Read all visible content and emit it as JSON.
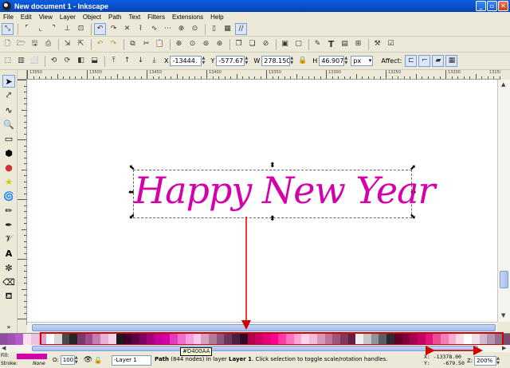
{
  "window": {
    "title": "New document 1 - Inkscape"
  },
  "menu": [
    "File",
    "Edit",
    "View",
    "Layer",
    "Object",
    "Path",
    "Text",
    "Filters",
    "Extensions",
    "Help"
  ],
  "toolbar": {
    "x_label": "X",
    "x_value": "-13444.",
    "y_label": "Y",
    "y_value": "-577.67",
    "w_label": "W",
    "w_value": "278.15C",
    "h_label": "H",
    "h_value": "46.907",
    "unit": "px",
    "affect_label": "Affect:"
  },
  "rulers": {
    "h_labels": [
      "13550",
      "13500",
      "13450",
      "13400",
      "13350",
      "13300",
      "13250",
      "13200",
      "13150"
    ]
  },
  "canvas": {
    "text": "Happy New Year",
    "text_color": "#d400aa"
  },
  "palette": {
    "tooltip": "#D400AA",
    "colors": [
      "#8f4e9e",
      "#a34fb3",
      "#b55cc9",
      "#f6e2f2",
      "#ecc2e3",
      "#d9a2cf",
      "#fbfbfb",
      "#d7d7d7",
      "#4a4a4a",
      "#262626",
      "#7a3a6e",
      "#9b4e8b",
      "#c27db3",
      "#e6b1d8",
      "#f0d4e8",
      "#1a1a1a",
      "#3b0030",
      "#5c0049",
      "#800066",
      "#a30082",
      "#c6009e",
      "#d400aa",
      "#e33abf",
      "#ee6fd1",
      "#f59ee0",
      "#fac8ee",
      "#d4a3c0",
      "#b07a9d",
      "#8c577c",
      "#6a365c",
      "#4b1f41",
      "#2f0a28",
      "#b3004e",
      "#cc0063",
      "#e6007a",
      "#ff0090",
      "#ff3aa8",
      "#ff72c0",
      "#ffa6d6",
      "#ffd4ea",
      "#f0bcd8",
      "#d698b9",
      "#bb7699",
      "#9f567b",
      "#82385e",
      "#661e44",
      "#eef0f0",
      "#c3c6c8",
      "#909498",
      "#5a5e62",
      "#2a2d30",
      "#640027",
      "#82003a",
      "#a6004f",
      "#c80066",
      "#e0147f",
      "#ed4b9a",
      "#f47cb6",
      "#f9abd0",
      "#fdd6e8",
      "#ffffff",
      "#ece0ea",
      "#d0b9cc",
      "#b494ae",
      "#966f8f",
      "#784d71"
    ]
  },
  "status": {
    "fill_label": "Fill:",
    "stroke_label": "Stroke:",
    "stroke_value": "None",
    "opacity_label": "O:",
    "opacity_value": "100",
    "layer": "-Layer 1",
    "message_prefix": "Path",
    "message_nodes": " (844 nodes) in layer ",
    "message_layer": "Layer 1",
    "message_suffix": ". Click selection to toggle scale/rotation handles.",
    "x_label": "X:",
    "x_value": "-13378.00",
    "y_label": "Y:",
    "y_value": "-679.50",
    "z_label": "Z:",
    "zoom": "200%"
  },
  "colors": {
    "accent": "#d400aa",
    "annotation": "#d10000",
    "titlebar": "#0a5fe0"
  }
}
